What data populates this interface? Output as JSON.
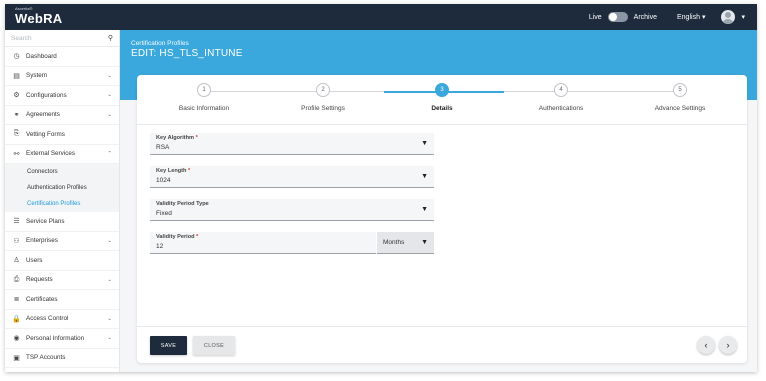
{
  "header": {
    "logo_small": "Ascertia®",
    "logo": "WebRA",
    "live_label": "Live",
    "archive_label": "Archive",
    "language": "English",
    "caret": "▾"
  },
  "sidebar": {
    "search_placeholder": "Search",
    "items": [
      {
        "label": "Dashboard",
        "icon": "◷",
        "chev": ""
      },
      {
        "label": "System",
        "icon": "▤",
        "chev": "⌄"
      },
      {
        "label": "Configurations",
        "icon": "⚙",
        "chev": "⌄"
      },
      {
        "label": "Agreements",
        "icon": "⚭",
        "chev": "⌄"
      },
      {
        "label": "Vetting Forms",
        "icon": "⎘",
        "chev": ""
      },
      {
        "label": "External Services",
        "icon": "⚯",
        "chev": "⌃"
      }
    ],
    "sub_items": [
      {
        "label": "Connectors"
      },
      {
        "label": "Authentication Profiles"
      },
      {
        "label": "Certification Profiles"
      }
    ],
    "items_after": [
      {
        "label": "Service Plans",
        "icon": "☰",
        "chev": ""
      },
      {
        "label": "Enterprises",
        "icon": "⚇",
        "chev": "⌄"
      },
      {
        "label": "Users",
        "icon": "♙",
        "chev": ""
      },
      {
        "label": "Requests",
        "icon": "⎙",
        "chev": "⌄"
      },
      {
        "label": "Certificates",
        "icon": "≣",
        "chev": ""
      },
      {
        "label": "Access Control",
        "icon": "🔒",
        "chev": "⌄"
      },
      {
        "label": "Personal Information",
        "icon": "◉",
        "chev": "⌄"
      },
      {
        "label": "TSP Accounts",
        "icon": "▣",
        "chev": ""
      }
    ]
  },
  "page": {
    "breadcrumb": "Certification Profiles",
    "title": "EDIT: HS_TLS_INTUNE"
  },
  "steps": [
    {
      "number": "1",
      "label": "Basic Information"
    },
    {
      "number": "2",
      "label": "Profile Settings"
    },
    {
      "number": "3",
      "label": "Details"
    },
    {
      "number": "4",
      "label": "Authentications"
    },
    {
      "number": "5",
      "label": "Advance Settings"
    }
  ],
  "active_step": 3,
  "form": {
    "key_algorithm": {
      "label": "Key Algorithm",
      "required": "*",
      "value": "RSA"
    },
    "key_length": {
      "label": "Key Length",
      "required": "*",
      "value": "1024"
    },
    "validity_type": {
      "label": "Validity Period Type",
      "value": "Fixed"
    },
    "validity_period": {
      "label": "Validity Period",
      "required": "*",
      "value": "12",
      "unit": "Months"
    },
    "dropdown_caret": "▼"
  },
  "footer": {
    "save_label": "SAVE",
    "close_label": "CLOSE",
    "prev_icon": "‹",
    "next_icon": "›"
  }
}
